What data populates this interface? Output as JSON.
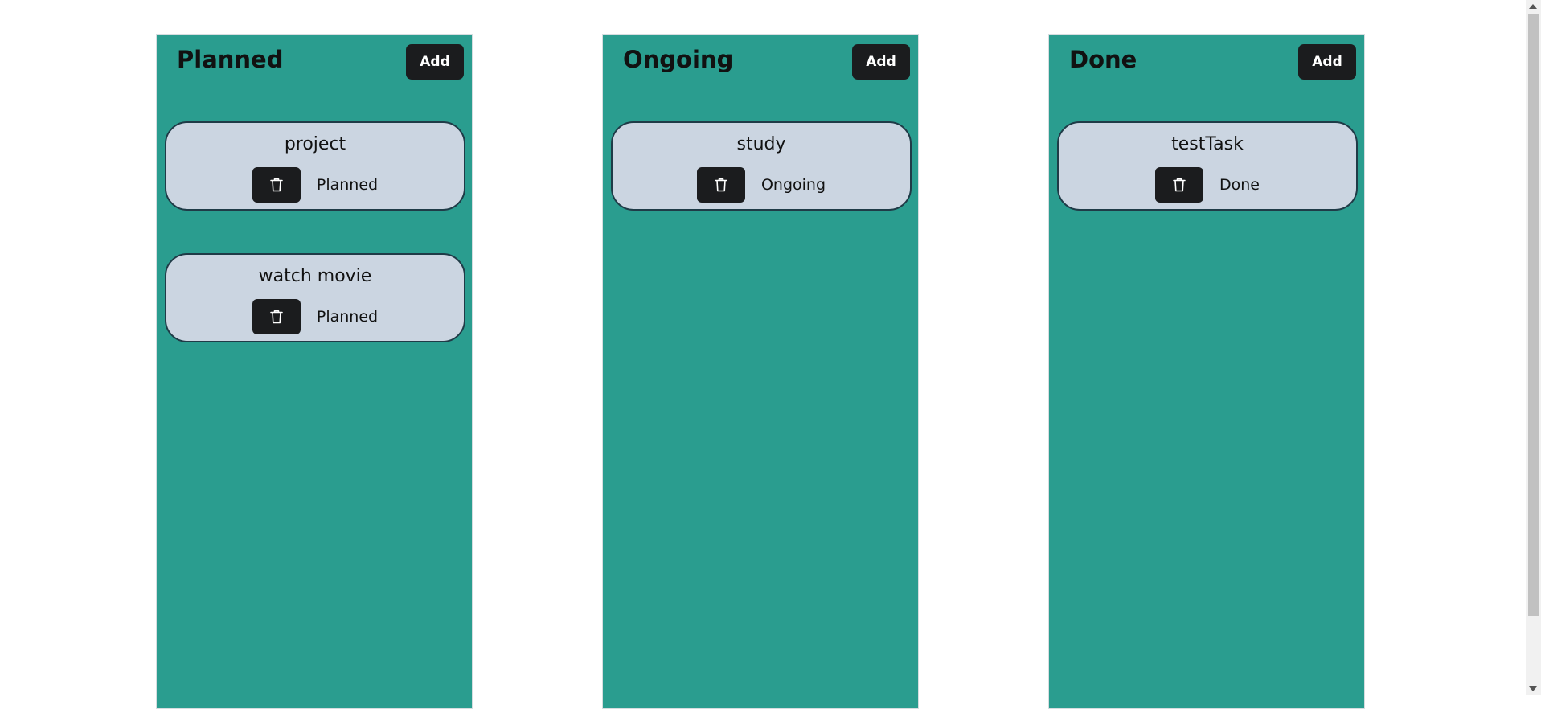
{
  "columns": [
    {
      "title": "Planned",
      "add_label": "Add",
      "tasks": [
        {
          "title": "project",
          "status": "Planned"
        },
        {
          "title": "watch movie",
          "status": "Planned"
        }
      ]
    },
    {
      "title": "Ongoing",
      "add_label": "Add",
      "tasks": [
        {
          "title": "study",
          "status": "Ongoing"
        }
      ]
    },
    {
      "title": "Done",
      "add_label": "Add",
      "tasks": [
        {
          "title": "testTask",
          "status": "Done"
        }
      ]
    }
  ],
  "icons": {
    "delete": "trash-icon"
  },
  "colors": {
    "column_bg": "#2a9d8f",
    "card_bg": "#cbd5e1",
    "button_bg": "#1b1c1e"
  }
}
